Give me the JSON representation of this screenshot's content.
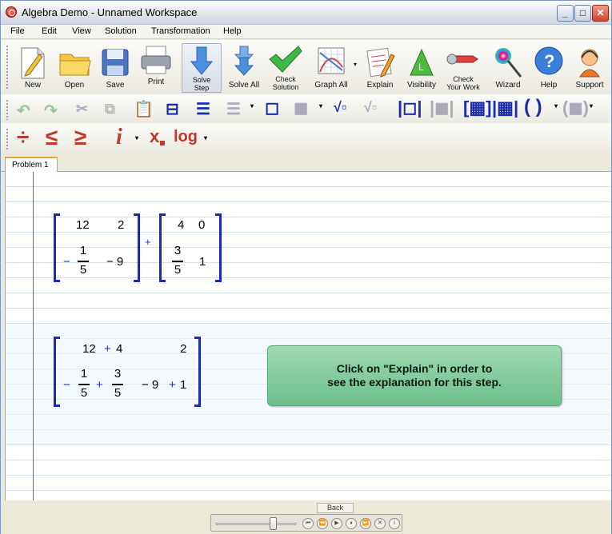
{
  "window": {
    "title": "Algebra Demo - Unnamed Workspace",
    "controls": {
      "minimize": "_",
      "maximize": "□",
      "close": "✕"
    }
  },
  "menu": [
    "File",
    "Edit",
    "View",
    "Solution",
    "Transformation",
    "Help"
  ],
  "toolbar": {
    "new": "New",
    "open": "Open",
    "save": "Save",
    "print": "Print",
    "solve_step_1": "Solve",
    "solve_step_2": "Step",
    "solve_all": "Solve All",
    "check_solution_1": "Check",
    "check_solution_2": "Solution",
    "graph_all": "Graph All",
    "explain": "Explain",
    "visibility": "Visibility",
    "check_work_1": "Check",
    "check_work_2": "Your Work",
    "wizard": "Wizard",
    "help": "Help",
    "support": "Support"
  },
  "math_toolbar": {
    "divide": "÷",
    "less_equal": "≤",
    "greater_equal": "≥",
    "imaginary": "i",
    "subscript_x": "x",
    "log": "log"
  },
  "tabs": [
    "Problem 1"
  ],
  "problem": {
    "matrix_a": {
      "r1c1": "12",
      "r1c2": "2",
      "r2c1_sign": "−",
      "r2c1_num": "1",
      "r2c1_den": "5",
      "r2c2": "− 9"
    },
    "operator": "+",
    "matrix_b": {
      "r1c1": "4",
      "r1c2": "0",
      "r2c1_num": "3",
      "r2c1_den": "5",
      "r2c2": "1"
    }
  },
  "step": {
    "r1c1_a": "12",
    "r1c1_op": "+",
    "r1c1_b": "4",
    "r1c2": "2",
    "r2c1_sign": "−",
    "r2c1_num1": "1",
    "r2c1_den1": "5",
    "r2c1_op": "+",
    "r2c1_num2": "3",
    "r2c1_den2": "5",
    "r2c2_a": "− 9",
    "r2c2_op": "+",
    "r2c2_b": "1"
  },
  "callout": {
    "line1": "Click on \"Explain\" in order to",
    "line2": "see the explanation for this step."
  },
  "footer": {
    "back": "Back",
    "player_buttons": [
      "⏮",
      "⏪",
      "▶",
      "⏸",
      "⏩",
      "✕",
      "i"
    ]
  },
  "colors": {
    "accent_blue": "#1a2bb0",
    "callout_green": "#6cc08d",
    "margin_red": "#c0504d"
  }
}
